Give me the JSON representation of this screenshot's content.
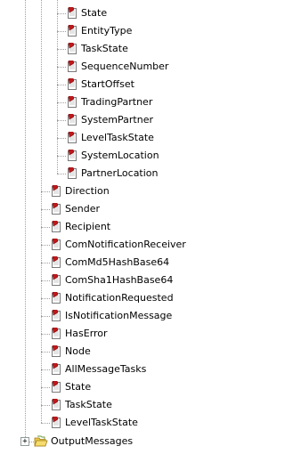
{
  "tree": {
    "nested_items": [
      {
        "label": "State"
      },
      {
        "label": "EntityType"
      },
      {
        "label": "TaskState"
      },
      {
        "label": "SequenceNumber"
      },
      {
        "label": "StartOffset"
      },
      {
        "label": "TradingPartner"
      },
      {
        "label": "SystemPartner"
      },
      {
        "label": "LevelTaskState"
      },
      {
        "label": "SystemLocation"
      },
      {
        "label": "PartnerLocation"
      }
    ],
    "items": [
      {
        "label": "Direction"
      },
      {
        "label": "Sender"
      },
      {
        "label": "Recipient"
      },
      {
        "label": "ComNotificationReceiver"
      },
      {
        "label": "ComMd5HashBase64"
      },
      {
        "label": "ComSha1HashBase64"
      },
      {
        "label": "NotificationRequested"
      },
      {
        "label": "IsNotificationMessage"
      },
      {
        "label": "HasError"
      },
      {
        "label": "Node"
      },
      {
        "label": "AllMessageTasks"
      },
      {
        "label": "State"
      },
      {
        "label": "TaskState"
      },
      {
        "label": "LevelTaskState"
      }
    ],
    "folder": {
      "label": "OutputMessages",
      "expander": "+"
    }
  },
  "colors": {
    "line": "#a0a0a0",
    "icon_red": "#c0181c",
    "folder": "#e8c848"
  },
  "icons": {
    "property": "property-document-icon",
    "folder": "folder-icon"
  }
}
